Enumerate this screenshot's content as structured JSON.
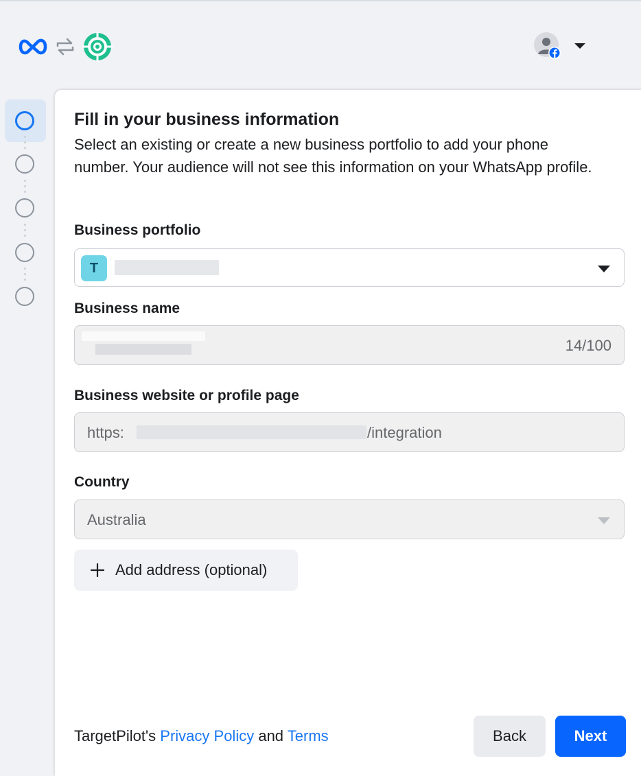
{
  "header": {
    "brand_icon": "meta-logo-icon",
    "link_icon": "swap-arrows-icon",
    "app_icon": "target-logo-icon",
    "account_icon": "user-avatar-icon",
    "account_badge_icon": "facebook-badge-icon",
    "menu_icon": "caret-down-icon"
  },
  "stepper": {
    "current_step": 1,
    "total_steps": 5
  },
  "form": {
    "title": "Fill in your business information",
    "description": "Select an existing or create a new business portfolio to add your phone number. Your audience will not see this information on your WhatsApp profile.",
    "portfolio": {
      "label": "Business portfolio",
      "avatar_letter": "T"
    },
    "business_name": {
      "label": "Business name",
      "counter": "14/100"
    },
    "website": {
      "label": "Business website or profile page",
      "prefix": "https:",
      "suffix": "/integration"
    },
    "country": {
      "label": "Country",
      "value": "Australia"
    },
    "add_address": {
      "label": "Add address (optional)",
      "icon": "plus-icon"
    }
  },
  "footer": {
    "company": "TargetPilot's",
    "privacy_link": "Privacy Policy",
    "and_text": "and",
    "terms_link": "Terms",
    "back_label": "Back",
    "next_label": "Next"
  },
  "colors": {
    "accent": "#1877f2",
    "primary_button": "#0866ff",
    "app_logo": "#1fbf8f"
  }
}
